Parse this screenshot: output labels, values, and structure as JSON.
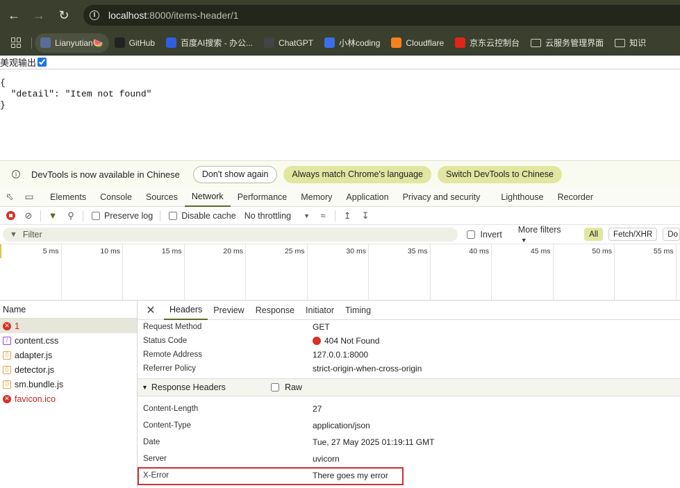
{
  "browser": {
    "url_host": "localhost",
    "url_rest": ":8000/items-header/1",
    "bookmarks": [
      {
        "label": "Lianyutian🍉",
        "color": "#5a6d9a"
      },
      {
        "label": "GitHub",
        "color": "#222222"
      },
      {
        "label": "百度AI搜索 - 办公...",
        "color": "#2f5ee0"
      },
      {
        "label": "ChatGPT",
        "color": "#444444"
      },
      {
        "label": "小林coding",
        "color": "#3d6ee8"
      },
      {
        "label": "Cloudflare",
        "color": "#f48120"
      },
      {
        "label": "京东云控制台",
        "color": "#e1251b"
      },
      {
        "label": "云服务管理界面",
        "color": "#cfcfc5"
      },
      {
        "label": "知识",
        "color": "#cfcfc5"
      }
    ]
  },
  "page": {
    "pretty_label": "美观输出",
    "json_text": "{\n  \"detail\": \"Item not found\"\n}"
  },
  "devtools": {
    "infobar": {
      "message": "DevTools is now available in Chinese",
      "dont_show": "Don't show again",
      "always_match": "Always match Chrome's language",
      "switch": "Switch DevTools to Chinese"
    },
    "tabs": [
      "Elements",
      "Console",
      "Sources",
      "Network",
      "Performance",
      "Memory",
      "Application",
      "Privacy and security",
      "Lighthouse",
      "Recorder"
    ],
    "selected_tab": "Network",
    "toolbar": {
      "preserve_log": "Preserve log",
      "disable_cache": "Disable cache",
      "throttling": "No throttling"
    },
    "filter": {
      "placeholder": "Filter",
      "invert": "Invert",
      "more_filters": "More filters",
      "chips": [
        "All",
        "Fetch/XHR",
        "Do"
      ]
    },
    "timeline_ticks": [
      "5 ms",
      "10 ms",
      "15 ms",
      "20 ms",
      "25 ms",
      "30 ms",
      "35 ms",
      "40 ms",
      "45 ms",
      "50 ms",
      "55 ms"
    ],
    "name_header": "Name",
    "requests": [
      {
        "name": "1",
        "type": "error"
      },
      {
        "name": "content.css",
        "type": "css"
      },
      {
        "name": "adapter.js",
        "type": "js"
      },
      {
        "name": "detector.js",
        "type": "js"
      },
      {
        "name": "sm.bundle.js",
        "type": "js"
      },
      {
        "name": "favicon.ico",
        "type": "error"
      }
    ],
    "detail_tabs": [
      "Headers",
      "Preview",
      "Response",
      "Initiator",
      "Timing"
    ],
    "general": [
      {
        "k": "Request Method",
        "v": "GET"
      },
      {
        "k": "Status Code",
        "v": "404 Not Found"
      },
      {
        "k": "Remote Address",
        "v": "127.0.0.1:8000"
      },
      {
        "k": "Referrer Policy",
        "v": "strict-origin-when-cross-origin"
      }
    ],
    "response_headers_title": "Response Headers",
    "raw_label": "Raw",
    "response_headers": [
      {
        "k": "Content-Length",
        "v": "27"
      },
      {
        "k": "Content-Type",
        "v": "application/json"
      },
      {
        "k": "Date",
        "v": "Tue, 27 May 2025 01:19:11 GMT"
      },
      {
        "k": "Server",
        "v": "uvicorn"
      },
      {
        "k": "X-Error",
        "v": "There goes my error"
      }
    ]
  }
}
